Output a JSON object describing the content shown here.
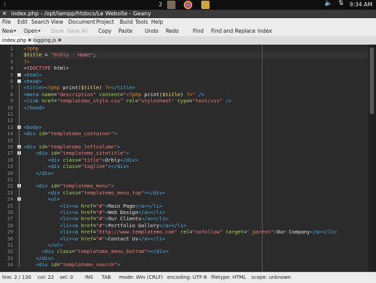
{
  "system_panel": {
    "workspace_number": "2",
    "clock": "9:34 AM"
  },
  "window": {
    "title": "index.php - /opt/lampp/htdocs/Le Website - Geany"
  },
  "menu": [
    "File",
    "Edit",
    "Search",
    "View",
    "Document",
    "Project",
    "Build",
    "Tools",
    "Help"
  ],
  "toolbar": {
    "new": "New",
    "open": "Open",
    "save": "Save",
    "save_all": "Save All",
    "copy": "Copy",
    "paste": "Paste",
    "undo": "Undo",
    "redo": "Redo",
    "find": "Find",
    "find_replace": "Find and Replace",
    "index": "Index"
  },
  "tabs": [
    {
      "label": "index.php",
      "active": true
    },
    {
      "label": "logging.js",
      "active": false
    }
  ],
  "editor": {
    "line_numbers": [
      "1",
      "2",
      "3",
      "4",
      "5",
      "6",
      "7",
      "8",
      "9",
      "10",
      "11",
      "12",
      "13",
      "14",
      "15",
      "16",
      "17",
      "18",
      "19",
      "20",
      "21",
      "22",
      "23",
      "24",
      "25",
      "26",
      "27",
      "28",
      "29",
      "30",
      "31",
      "32",
      "33",
      "34"
    ],
    "lines": [
      [
        [
          "ph",
          "<?php"
        ]
      ],
      [
        [
          "vr",
          "$title"
        ],
        [
          "tx",
          " = "
        ],
        [
          "st",
          "\"Orbly - Home\""
        ],
        [
          "tx",
          ";"
        ]
      ],
      [
        [
          "ph",
          "?>"
        ]
      ],
      [
        [
          "tx",
          "<!"
        ],
        [
          "st",
          "DOCTYPE"
        ],
        [
          "tx",
          " html>"
        ]
      ],
      [
        [
          "tg",
          "<html>"
        ]
      ],
      [
        [
          "tg",
          "<head>"
        ]
      ],
      [
        [
          "tg",
          "<title>"
        ],
        [
          "ph",
          "<?php"
        ],
        [
          "tx",
          " print("
        ],
        [
          "vr",
          "$title"
        ],
        [
          "tx",
          ") "
        ],
        [
          "ph",
          "?>"
        ],
        [
          "tg",
          "</title>"
        ]
      ],
      [
        [
          "tg",
          "<meta "
        ],
        [
          "at",
          "name"
        ],
        [
          "tx",
          "="
        ],
        [
          "st",
          "\"description\""
        ],
        [
          "at",
          " content"
        ],
        [
          "tx",
          "="
        ],
        [
          "st",
          "\""
        ],
        [
          "ph",
          "<?php"
        ],
        [
          "tx",
          " print("
        ],
        [
          "vr",
          "$title"
        ],
        [
          "tx",
          ") "
        ],
        [
          "ph",
          "?>"
        ],
        [
          "st",
          "\""
        ],
        [
          "tg",
          " />"
        ]
      ],
      [
        [
          "tg",
          "<link "
        ],
        [
          "at",
          "href"
        ],
        [
          "tx",
          "="
        ],
        [
          "st",
          "\"templatemo_style.css\""
        ],
        [
          "at",
          " rel"
        ],
        [
          "tx",
          "="
        ],
        [
          "st",
          "\"stylesheet\""
        ],
        [
          "at",
          " type"
        ],
        [
          "tx",
          "="
        ],
        [
          "st",
          "\"text/css\""
        ],
        [
          "tg",
          " />"
        ]
      ],
      [
        [
          "tg",
          "</head>"
        ]
      ],
      [
        [
          "tx",
          ""
        ]
      ],
      [
        [
          "tx",
          ""
        ]
      ],
      [
        [
          "tg",
          "<body>"
        ]
      ],
      [
        [
          "tg",
          "<div "
        ],
        [
          "at",
          "id"
        ],
        [
          "tx",
          "="
        ],
        [
          "st",
          "\"templatemo_container\""
        ],
        [
          "tg",
          ">"
        ]
      ],
      [
        [
          "tx",
          ""
        ]
      ],
      [
        [
          "tg",
          "<div "
        ],
        [
          "at",
          "id"
        ],
        [
          "tx",
          "="
        ],
        [
          "st",
          "\"templatemo_leftcolumn\""
        ],
        [
          "tg",
          ">"
        ]
      ],
      [
        [
          "tx",
          "    "
        ],
        [
          "tg",
          "<div "
        ],
        [
          "at",
          "id"
        ],
        [
          "tx",
          "="
        ],
        [
          "st",
          "\"templatemo_sitetitle\""
        ],
        [
          "tg",
          ">"
        ]
      ],
      [
        [
          "tx",
          "        "
        ],
        [
          "tg",
          "<div "
        ],
        [
          "at",
          "class"
        ],
        [
          "tx",
          "="
        ],
        [
          "st",
          "\"title\""
        ],
        [
          "tg",
          ">"
        ],
        [
          "tx",
          "Orbly"
        ],
        [
          "tg",
          "</div>"
        ]
      ],
      [
        [
          "tx",
          "        "
        ],
        [
          "tg",
          "<div "
        ],
        [
          "at",
          "class"
        ],
        [
          "tx",
          "="
        ],
        [
          "st",
          "\"tagline\""
        ],
        [
          "tg",
          "></div>"
        ]
      ],
      [
        [
          "tx",
          "    "
        ],
        [
          "tg",
          "</div>"
        ]
      ],
      [
        [
          "tx",
          ""
        ]
      ],
      [
        [
          "tx",
          "    "
        ],
        [
          "tg",
          "<div "
        ],
        [
          "at",
          "id"
        ],
        [
          "tx",
          "="
        ],
        [
          "st",
          "\"templatemo_menu\""
        ],
        [
          "tg",
          ">"
        ]
      ],
      [
        [
          "tx",
          "        "
        ],
        [
          "tg",
          "<div "
        ],
        [
          "at",
          "class"
        ],
        [
          "tx",
          "="
        ],
        [
          "st",
          "\"templatemo_menu_top\""
        ],
        [
          "tg",
          "></div>"
        ]
      ],
      [
        [
          "tx",
          "        "
        ],
        [
          "tg",
          "<ul>"
        ]
      ],
      [
        [
          "tx",
          "            "
        ],
        [
          "tg",
          "<li><a "
        ],
        [
          "at",
          "href"
        ],
        [
          "tx",
          "="
        ],
        [
          "st",
          "\"#\""
        ],
        [
          "tg",
          ">"
        ],
        [
          "tx",
          "Main Page"
        ],
        [
          "tg",
          "</a></li>"
        ]
      ],
      [
        [
          "tx",
          "            "
        ],
        [
          "tg",
          "<li><a "
        ],
        [
          "at",
          "href"
        ],
        [
          "tx",
          "="
        ],
        [
          "st",
          "\"#\""
        ],
        [
          "tg",
          ">"
        ],
        [
          "tx",
          "Web Design"
        ],
        [
          "tg",
          "</a></li>"
        ]
      ],
      [
        [
          "tx",
          "            "
        ],
        [
          "tg",
          "<li><a "
        ],
        [
          "at",
          "href"
        ],
        [
          "tx",
          "="
        ],
        [
          "st",
          "\"#\""
        ],
        [
          "tg",
          ">"
        ],
        [
          "tx",
          "Our Clients"
        ],
        [
          "tg",
          "</a></li>"
        ]
      ],
      [
        [
          "tx",
          "            "
        ],
        [
          "tg",
          "<li><a "
        ],
        [
          "at",
          "href"
        ],
        [
          "tx",
          "="
        ],
        [
          "st",
          "\"#\""
        ],
        [
          "tg",
          ">"
        ],
        [
          "tx",
          "Portfolio Gallery"
        ],
        [
          "tg",
          "</a></li>"
        ]
      ],
      [
        [
          "tx",
          "            "
        ],
        [
          "tg",
          "<li><a "
        ],
        [
          "at",
          "href"
        ],
        [
          "tx",
          "="
        ],
        [
          "st",
          "\"http://www.templatemo.com\""
        ],
        [
          "at",
          " rel"
        ],
        [
          "tx",
          "="
        ],
        [
          "st",
          "\"nofollow\""
        ],
        [
          "at",
          " target"
        ],
        [
          "tx",
          "="
        ],
        [
          "st",
          "\"_parent\""
        ],
        [
          "tg",
          ">"
        ],
        [
          "tx",
          "Our Company"
        ],
        [
          "tg",
          "</a></li>"
        ]
      ],
      [
        [
          "tx",
          "            "
        ],
        [
          "tg",
          "<li><a "
        ],
        [
          "at",
          "href"
        ],
        [
          "tx",
          "="
        ],
        [
          "st",
          "\"#\""
        ],
        [
          "tg",
          ">"
        ],
        [
          "tx",
          "Contact Us"
        ],
        [
          "tg",
          "</a></li>"
        ]
      ],
      [
        [
          "tx",
          "        "
        ],
        [
          "tg",
          "</ul>"
        ]
      ],
      [
        [
          "tx",
          "      "
        ],
        [
          "tg",
          "<div "
        ],
        [
          "at",
          "class"
        ],
        [
          "tx",
          "="
        ],
        [
          "st",
          "\"templatemo_menu_bottom\""
        ],
        [
          "tg",
          "></div>"
        ]
      ],
      [
        [
          "tx",
          "    "
        ],
        [
          "tg",
          "</div>"
        ]
      ],
      [
        [
          "tx",
          "    "
        ],
        [
          "tg",
          "<div "
        ],
        [
          "at",
          "id"
        ],
        [
          "tx",
          "="
        ],
        [
          "st",
          "\"templatemo_search\""
        ],
        [
          "tg",
          ">"
        ]
      ]
    ],
    "colors": {
      "tag": "#4fb3e8",
      "attribute": "#a6d64b",
      "string": "#f27b7b",
      "php": "#e0902a",
      "variable": "#f0e068",
      "text": "#e0e0e0",
      "background": "#2b2b2b"
    }
  },
  "status": {
    "line": "line: 2 / 130",
    "col": "col: 22",
    "sel": "sel: 0",
    "ins": "INS",
    "tab": "TAB",
    "mode": "mode: Win (CRLF)",
    "encoding": "encoding: UTF-8",
    "filetype": "filetype: HTML",
    "scope": "scope: unknown"
  }
}
